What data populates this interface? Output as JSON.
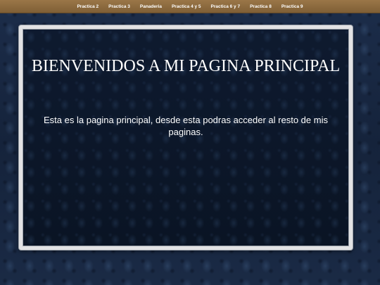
{
  "nav": {
    "items": [
      {
        "label": "Practica 2"
      },
      {
        "label": "Practica 3"
      },
      {
        "label": "Panaderia"
      },
      {
        "label": "Practica 4 y 5"
      },
      {
        "label": "Practica 6 y 7"
      },
      {
        "label": "Practica 8"
      },
      {
        "label": "Practica 9"
      }
    ]
  },
  "main": {
    "title": "BIENVENIDOS A MI PAGINA PRINCIPAL",
    "description": "Esta es la pagina principal, desde esta podras acceder al resto de mis paginas."
  },
  "colors": {
    "nav_background": "#8b6a3e",
    "page_background": "#16243d",
    "frame_border": "#e2e2e4",
    "text": "#ffffff"
  }
}
